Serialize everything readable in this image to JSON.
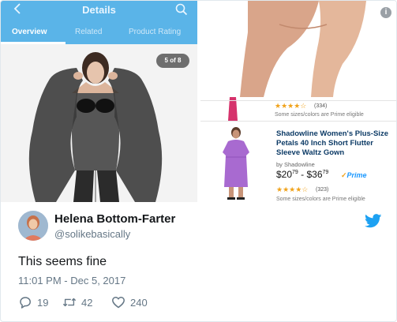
{
  "phone": {
    "header_title": "Details",
    "tabs": [
      {
        "label": "Overview",
        "active": true
      },
      {
        "label": "Related",
        "active": false
      },
      {
        "label": "Product Rating",
        "active": false
      }
    ],
    "slide_counter": "5 of 8"
  },
  "listing_top": {
    "rating_count": "(334)",
    "note": "Some sizes/colors are Prime eligible"
  },
  "listing_bottom": {
    "title": "Shadowline Women's Plus-Size Petals 40 Inch Short Flutter Sleeve Waltz Gown",
    "brand": "by Shadowline",
    "price_low_whole": "$20",
    "price_low_cents": "79",
    "price_sep": " - ",
    "price_high_whole": "$36",
    "price_high_cents": "79",
    "prime_label": "Prime",
    "rating_count": "(323)",
    "note": "Some sizes/colors are Prime eligible"
  },
  "tweet": {
    "display_name": "Helena Bottom-Farter",
    "handle": "@solikebasically",
    "text": "This seems fine",
    "timestamp": "11:01 PM - Dec 5, 2017",
    "replies": "19",
    "retweets": "42",
    "likes": "240"
  },
  "colors": {
    "app_header": "#5ab4e8",
    "twitter_blue": "#1da1f2",
    "meta_gray": "#657786",
    "star": "#f0a21a",
    "gown_purple": "#a86ad0"
  }
}
